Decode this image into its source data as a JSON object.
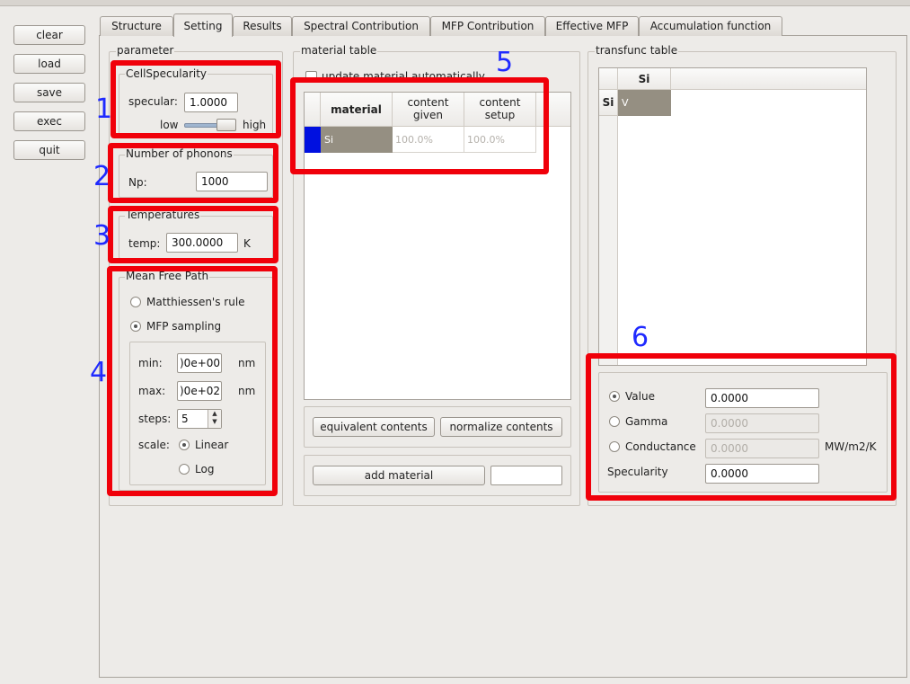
{
  "left_buttons": [
    "clear",
    "load",
    "save",
    "exec",
    "quit"
  ],
  "tabs": [
    "Structure",
    "Setting",
    "Results",
    "Spectral Contribution",
    "MFP Contribution",
    "Effective MFP",
    "Accumulation function"
  ],
  "parameter": {
    "title": "parameter",
    "cell_specularity": {
      "title": "CellSpecularity",
      "specular_label": "specular:",
      "specular_value": "1.0000",
      "low_label": "low",
      "high_label": "high"
    },
    "phonons": {
      "title": "Number of phonons",
      "np_label": "Np:",
      "np_value": "1000"
    },
    "temperatures": {
      "title": "Temperatures",
      "temp_label": "temp:",
      "temp_value": "300.0000",
      "unit": "K"
    },
    "mfp": {
      "title": "Mean Free Path",
      "matthiessen_label": "Matthiessen's rule",
      "sampling_label": "MFP sampling",
      "min_label": "min:",
      "min_value": ")0e+00",
      "min_unit": "nm",
      "max_label": "max:",
      "max_value": ")0e+02",
      "max_unit": "nm",
      "steps_label": "steps:",
      "steps_value": "5",
      "scale_label": "scale:",
      "linear_label": "Linear",
      "log_label": "Log"
    }
  },
  "material_table": {
    "title": "material table",
    "update_label": "update material automatically",
    "headers": {
      "material": "material",
      "content_given_1": "content",
      "content_given_2": "given",
      "content_setup_1": "content",
      "content_setup_2": "setup"
    },
    "row": {
      "material": "Si",
      "content_given": "100.0%",
      "content_setup": "100.0%"
    },
    "equivalent_button": "equivalent contents",
    "normalize_button": "normalize contents",
    "add_button": "add material",
    "add_input_value": ""
  },
  "transfunc_table": {
    "title": "transfunc table",
    "col_header": "Si",
    "row_header": "Si",
    "cell_value": "V",
    "value_label": "Value",
    "value_value": "0.0000",
    "gamma_label": "Gamma",
    "gamma_value": "0.0000",
    "conductance_label": "Conductance",
    "conductance_value": "0.0000",
    "conductance_unit": "MW/m2/K",
    "specularity_label": "Specularity",
    "specularity_value": "0.0000"
  },
  "annotations": [
    "1",
    "2",
    "3",
    "4",
    "5",
    "6"
  ],
  "colors": {
    "annotation_box": "#f0000a",
    "annotation_number": "#1f2aff",
    "selected_cell": "#958f82",
    "row_marker": "#0010e0"
  }
}
